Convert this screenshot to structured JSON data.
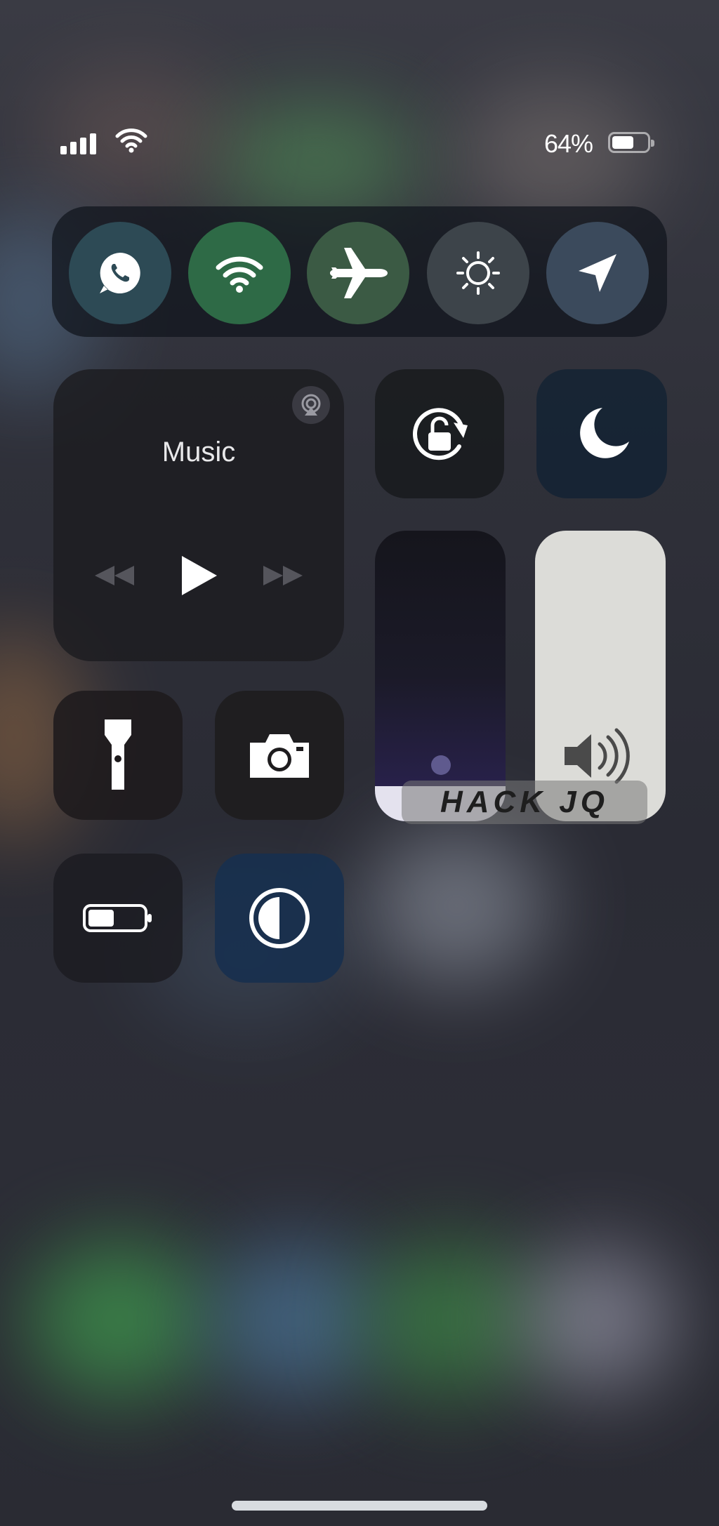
{
  "status": {
    "battery_percent": "64%",
    "battery_fraction": 0.64
  },
  "connectivity": [
    {
      "name": "whatsapp",
      "icon": "whatsapp-icon",
      "active": true
    },
    {
      "name": "wifi",
      "icon": "wifi-icon",
      "active": true
    },
    {
      "name": "airplane-mode",
      "icon": "airplane-icon",
      "active": false
    },
    {
      "name": "brightness",
      "icon": "sun-icon",
      "active": false
    },
    {
      "name": "location",
      "icon": "location-arrow-icon",
      "active": false
    }
  ],
  "music": {
    "title": "Music"
  },
  "sliders": {
    "brightness_level": 0.12,
    "volume_level": 1.0
  },
  "watermark": "HACK JQ",
  "colors": {
    "wifi_active": "#2e6a46",
    "invert_tile": "#18304e",
    "moon_tile": "#162434"
  }
}
